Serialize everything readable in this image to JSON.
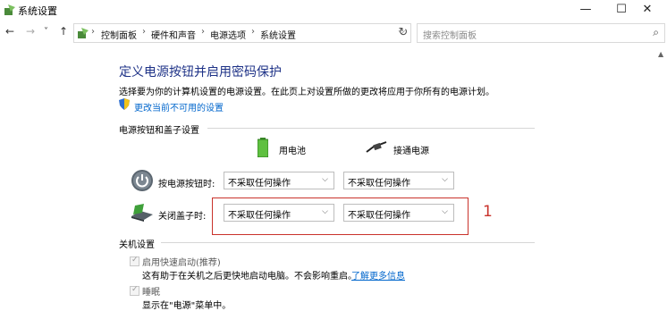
{
  "window": {
    "title": "系统设置",
    "minimize": "—",
    "maximize": "☐",
    "close": "✕"
  },
  "nav": {
    "back": "←",
    "forward": "→",
    "recent": "˅",
    "up": "↑",
    "breadcrumb": [
      "控制面板",
      "硬件和声音",
      "电源选项",
      "系统设置"
    ],
    "sep": "›",
    "dropdown": "⌵",
    "refresh": "↻",
    "search_placeholder": "搜索控制面板",
    "search_icon": "⌕"
  },
  "content": {
    "heading": "定义电源按钮并启用密码保护",
    "description": "选择要为你的计算机设置的电源设置。在此页上对设置所做的更改将应用于你所有的电源计划。",
    "change_link": "更改当前不可用的设置",
    "section_power": "电源按钮和盖子设置",
    "col_battery": "用电池",
    "col_plugged": "接通电源",
    "rows": [
      {
        "label": "按电源按钮时:",
        "battery": "不采取任何操作",
        "plugged": "不采取任何操作"
      },
      {
        "label": "关闭盖子时:",
        "battery": "不采取任何操作",
        "plugged": "不采取任何操作"
      }
    ],
    "dropdown_arrow": "⌵",
    "annotation_number": "1",
    "section_shutdown": "关机设置",
    "fast_startup_label": "启用快速启动(推荐)",
    "fast_startup_note": "这有助于在关机之后更快地启动电脑。不会影响重启。",
    "learn_more": "了解更多信息",
    "sleep_label": "睡眠",
    "sleep_note": "显示在\"电源\"菜单中。",
    "check": "✓"
  },
  "colors": {
    "heading": "#1e3287",
    "link": "#0066cc",
    "annotation": "#c9322b"
  }
}
